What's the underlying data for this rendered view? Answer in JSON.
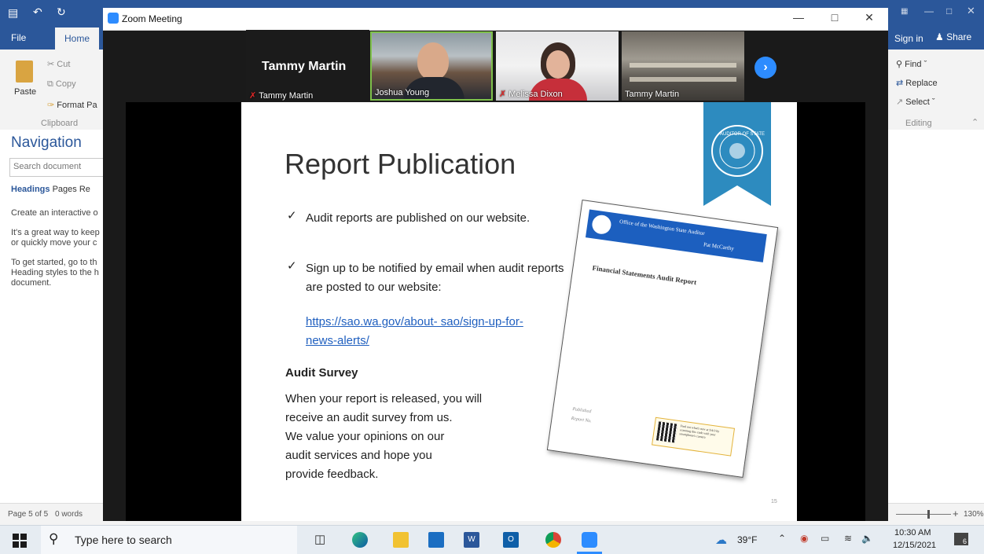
{
  "word": {
    "tabs": {
      "file": "File",
      "home": "Home"
    },
    "sign_in": "Sign in",
    "share": "Share",
    "clipboard": {
      "paste": "Paste",
      "cut": "Cut",
      "copy": "Copy",
      "format_painter": "Format Pa",
      "group": "Clipboard"
    },
    "editing": {
      "find": "Find",
      "replace": "Replace",
      "select": "Select",
      "group": "Editing"
    },
    "nav": {
      "title": "Navigation",
      "search_placeholder": "Search document",
      "tabs": [
        "Headings",
        "Pages",
        "Re"
      ],
      "lines": [
        "Create an interactive o",
        "It's a great way to keep",
        "or quickly move your c",
        "To get started, go to th",
        "Heading styles to the h",
        "document."
      ]
    },
    "status": {
      "page": "Page 5 of 5",
      "words": "0 words",
      "zoom": "130%"
    }
  },
  "zoom": {
    "title": "Zoom Meeting",
    "speaker_label": "Tammy Martin",
    "speaker_name_tag": "Tammy Martin",
    "participants": [
      {
        "name": "Joshua Young"
      },
      {
        "name": "Melissa Dixon"
      },
      {
        "name": "Tammy Martin"
      }
    ]
  },
  "slide": {
    "title": "Report Publication",
    "bullets": [
      "Audit reports are published on our website.",
      "Sign up to be notified by email when audit reports are posted to our website:"
    ],
    "link": "https://sao.wa.gov/about- sao/sign-up-for-news-alerts/",
    "survey_heading": "Audit Survey",
    "survey_lines": [
      "When your report is released, you will",
      "receive an audit survey from us.",
      "We value your opinions on our",
      "audit services and hope you",
      "provide feedback."
    ],
    "doc_office": "Office of the Washington State Auditor",
    "doc_person": "Pat McCarthy",
    "doc_title": "Financial Statements Audit Report",
    "doc_published": "Published",
    "doc_report_no": "Report No.",
    "doc_qr_text": "Find out what's new at SAO by scanning this code with your smartphone's camera",
    "seal_text": "AUDITOR OF STATE",
    "page_num": "15"
  },
  "taskbar": {
    "search_placeholder": "Type here to search",
    "weather": "39°F",
    "time": "10:30 AM",
    "date": "12/15/2021",
    "notif_count": "6"
  }
}
